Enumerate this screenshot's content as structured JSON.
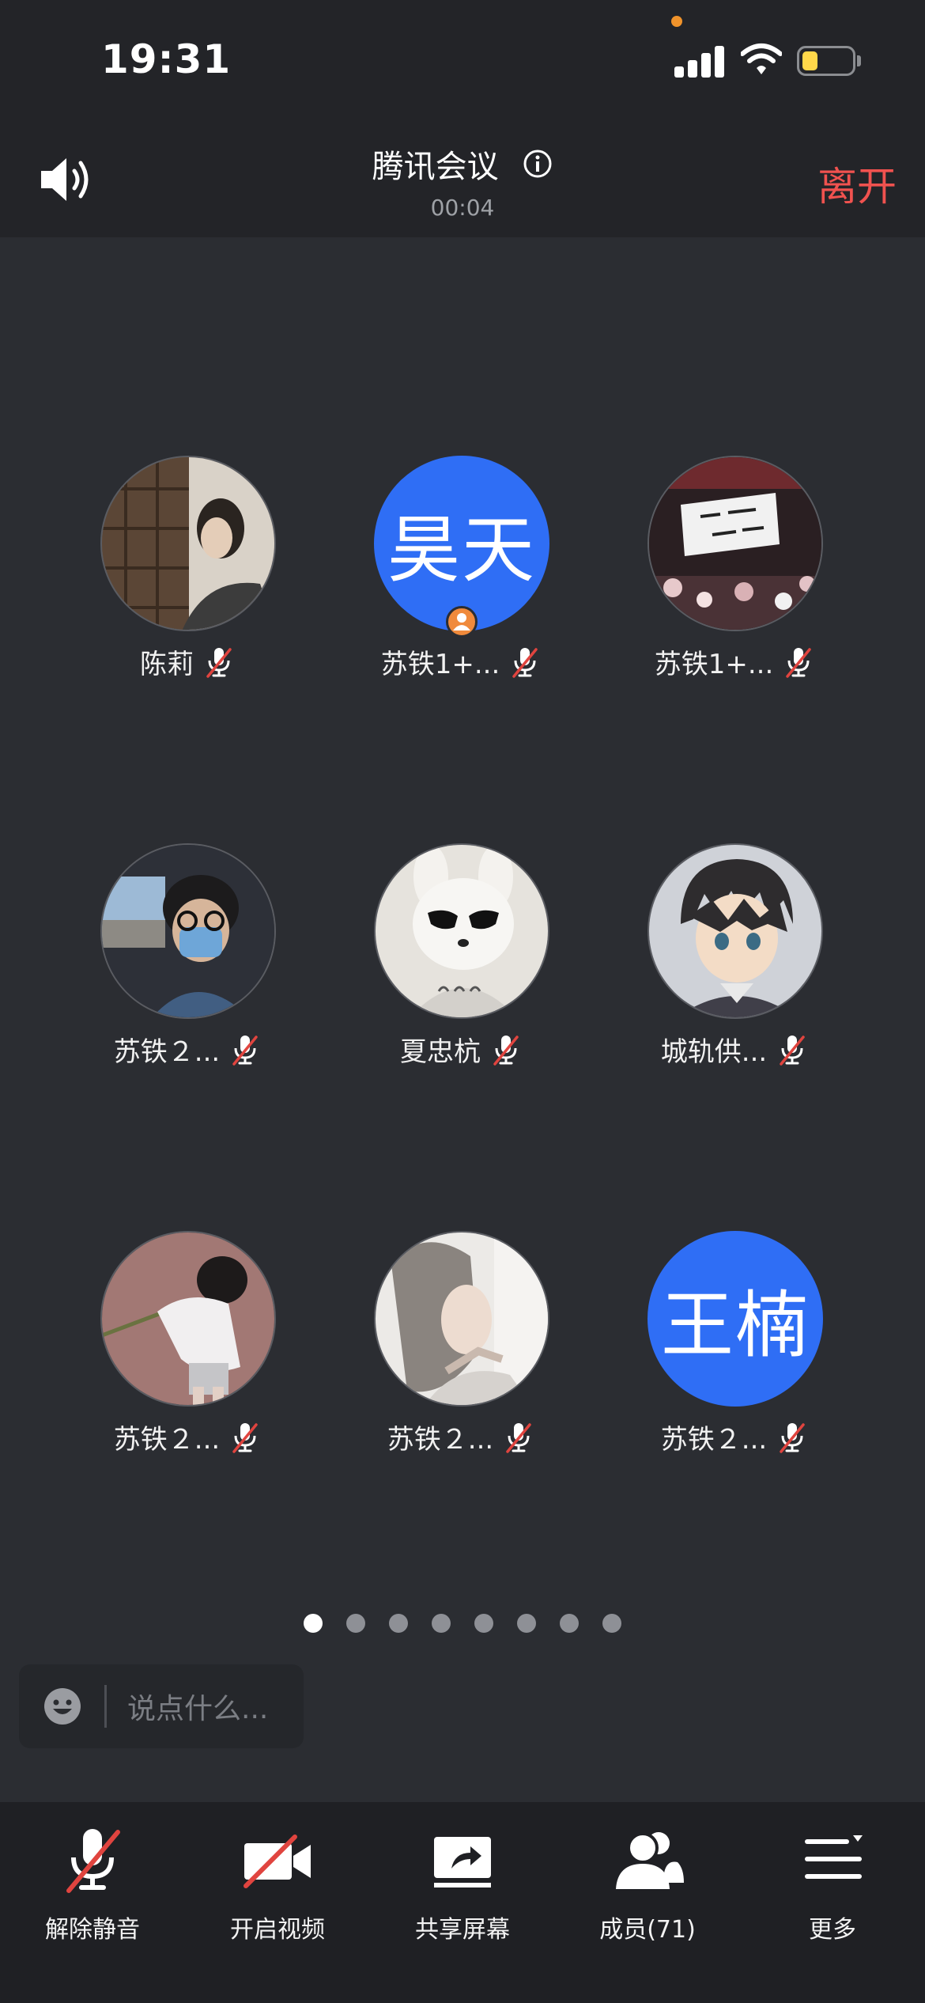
{
  "status_bar": {
    "time": "19:31",
    "battery_level": 0.3
  },
  "header": {
    "speaker_icon": "speaker-icon",
    "title": "腾讯会议",
    "info_icon": "info-icon",
    "elapsed": "00:04",
    "leave_label": "离开"
  },
  "participants": [
    {
      "name": "陈莉",
      "avatar": "photo",
      "muted": true
    },
    {
      "name": "苏铁1+...",
      "avatar_text": "昊天",
      "is_host": true,
      "muted": true
    },
    {
      "name": "苏铁1+...",
      "avatar": "photo",
      "muted": true
    },
    {
      "name": "苏铁２...",
      "avatar": "photo",
      "muted": true
    },
    {
      "name": "夏忠杭",
      "avatar": "photo",
      "muted": true
    },
    {
      "name": "城轨供...",
      "avatar": "photo",
      "muted": true
    },
    {
      "name": "苏铁２...",
      "avatar": "photo",
      "muted": true
    },
    {
      "name": "苏铁２...",
      "avatar": "photo",
      "muted": true
    },
    {
      "name": "苏铁２...",
      "avatar_text": "王楠",
      "muted": true
    }
  ],
  "pagination": {
    "total_pages": 8,
    "current_page": 1
  },
  "chat": {
    "placeholder": "说点什么..."
  },
  "toolbar": {
    "unmute_label": "解除静音",
    "video_label": "开启视频",
    "share_label": "共享屏幕",
    "members_label": "成员(71)",
    "more_label": "更多"
  },
  "colors": {
    "accent_blue": "#2f6ef5",
    "leave_red": "#f0524f",
    "muted_red": "#e0443f",
    "host_orange": "#f08a3c",
    "battery_yellow": "#ffd84a",
    "status_orange": "#f0932b"
  }
}
